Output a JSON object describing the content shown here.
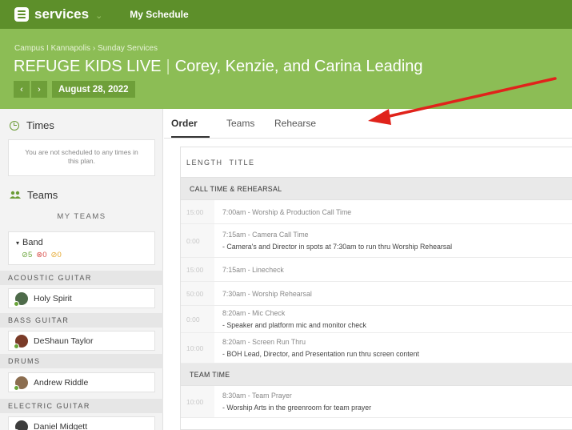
{
  "topbar": {
    "app_name": "services",
    "caret": "⌄",
    "nav_link": "My Schedule",
    "logo_icon": "services-logo-icon"
  },
  "header": {
    "breadcrumb": "Campus I Kannapolis › Sunday Services",
    "service_type": "REFUGE KIDS LIVE",
    "separator": "|",
    "plan_title": "Corey, Kenzie, and Carina Leading",
    "prev_label": "‹",
    "next_label": "›",
    "date": "August 28, 2022"
  },
  "sidebar": {
    "times_heading": "Times",
    "notice_text": "You are not scheduled to any times in this plan.",
    "teams_heading": "Teams",
    "my_teams_label": "MY TEAMS",
    "band": {
      "name": "Band",
      "bullet": "▾",
      "confirmed": "⊘5",
      "declined": "⊗0",
      "pending": "⊘0"
    },
    "positions": [
      {
        "label": "ACOUSTIC GUITAR",
        "person": "Holy Spirit"
      },
      {
        "label": "BASS GUITAR",
        "person": "DeShaun Taylor"
      },
      {
        "label": "DRUMS",
        "person": "Andrew Riddle"
      },
      {
        "label": "ELECTRIC GUITAR",
        "person": "Daniel Midgett"
      }
    ]
  },
  "main": {
    "tabs": [
      {
        "label": "Order",
        "active": true
      },
      {
        "label": "Teams",
        "active": false
      },
      {
        "label": "Rehearse",
        "active": false
      }
    ],
    "columns": {
      "length": "LENGTH",
      "title": "TITLE"
    },
    "sections": [
      {
        "header": "CALL TIME & REHEARSAL",
        "items": [
          {
            "length": "15:00",
            "title": "7:00am - Worship & Production Call Time",
            "note": ""
          },
          {
            "length": "0:00",
            "title": "7:15am - Camera Call Time",
            "note": "- Camera's and Director in spots at 7:30am to run thru  Worship Rehearsal"
          },
          {
            "length": "15:00",
            "title": "7:15am - Linecheck",
            "note": ""
          },
          {
            "length": "50:00",
            "title": "7:30am - Worship Rehearsal",
            "note": ""
          },
          {
            "length": "0:00",
            "title": "8:20am - Mic Check",
            "note": "- Speaker and platform mic and monitor check"
          },
          {
            "length": "10:00",
            "title": "8:20am - Screen Run Thru",
            "note": "- BOH Lead, Director, and Presentation run thru screen content"
          }
        ]
      },
      {
        "header": "TEAM TIME",
        "items": [
          {
            "length": "10:00",
            "title": "8:30am - Team Prayer",
            "note": "- Worship Arts in the greenroom for team prayer"
          }
        ]
      }
    ]
  },
  "colors": {
    "topbar": "#5d8f2a",
    "header": "#8cbd55",
    "accent": "#6b9b36",
    "annotation_arrow": "#e0231b"
  }
}
